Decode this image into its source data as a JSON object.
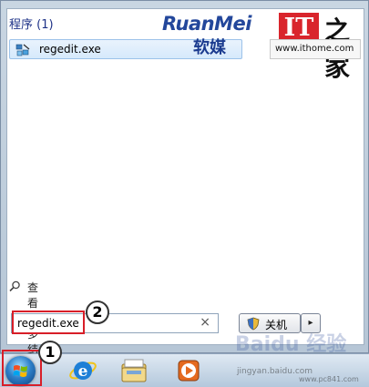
{
  "start_menu": {
    "group_header": "程序 (1)",
    "result_item": {
      "label": "regedit.exe",
      "icon": "registry-editor-icon"
    },
    "see_more_label": "查看更多结果",
    "watermark_ruanmei": "RuanMei",
    "watermark_ruanmei_cn": "软媒",
    "ithome_logo_text": "IT",
    "ithome_logo_glyph": "之家",
    "ithome_url": "www.ithome.com"
  },
  "search": {
    "value": "regedit.exe",
    "clear_symbol": "×"
  },
  "shutdown": {
    "label": "关机",
    "arrow_symbol": "▸",
    "icon": "shield-icon"
  },
  "annotations": {
    "step_1": "1",
    "step_2": "2"
  },
  "taskbar": {
    "items": [
      {
        "name": "start-orb",
        "icon": "windows-flag-icon"
      },
      {
        "name": "internet-explorer",
        "icon": "internet-explorer-icon"
      },
      {
        "name": "windows-explorer",
        "icon": "folder-icon"
      },
      {
        "name": "media-player",
        "icon": "media-player-icon"
      }
    ]
  },
  "watermarks": {
    "baidu": "Baidu 经验",
    "jingyan_url": "jingyan.baidu.com",
    "pc_url": "www.pc841.com"
  },
  "colors": {
    "highlight_red": "#d81e28",
    "header_blue": "#1e3287",
    "ithome_red": "#d9252c"
  }
}
